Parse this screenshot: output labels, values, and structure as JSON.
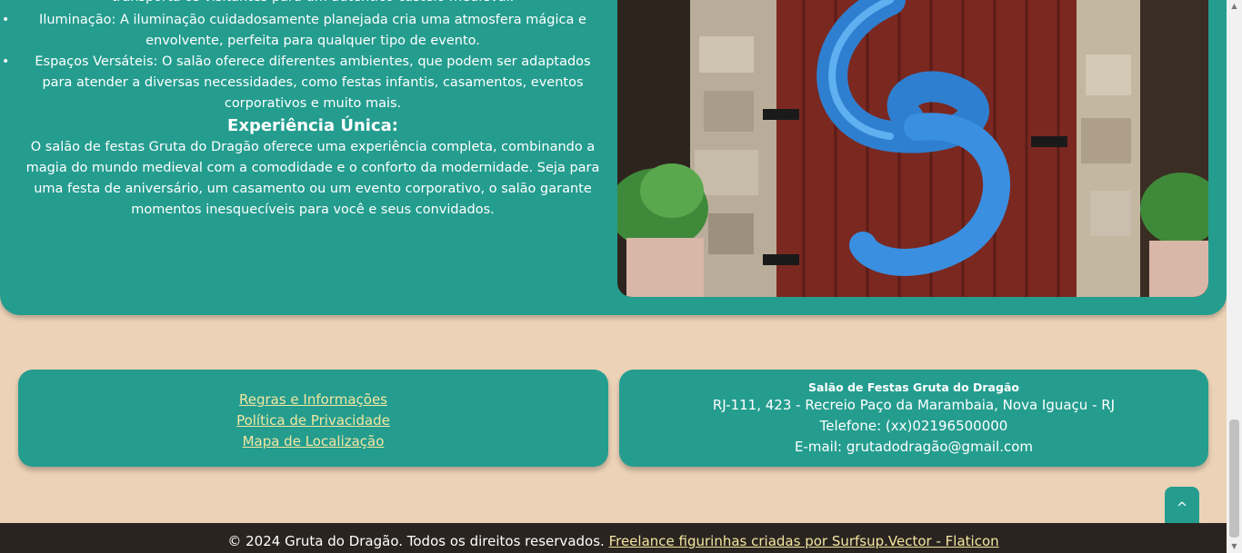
{
  "content": {
    "cut_line": "transporta os visitantes para um autêntico castelo medieval.",
    "bullets": [
      "Iluminação: A iluminação cuidadosamente planejada cria uma atmosfera mágica e envolvente, perfeita para qualquer tipo de evento.",
      "Espaços Versáteis: O salão oferece diferentes ambientes, que podem ser adaptados para atender a diversas necessidades, como festas infantis, casamentos, eventos corporativos e muito mais."
    ],
    "section_title": "Experiência Única:",
    "paragraph": "O salão de festas Gruta do Dragão oferece uma experiência completa, combinando a magia do mundo medieval com a comodidade e o conforto da modernidade. Seja para uma festa de aniversário, um casamento ou um evento corporativo, o salão garante momentos inesquecíveis para você e seus convidados."
  },
  "footer": {
    "links": [
      "Regras e Informações",
      "Política de Privacidade",
      "Mapa de Localização"
    ],
    "info": {
      "name": "Salão de Festas Gruta do Dragão",
      "address": "RJ-111, 423 - Recreio Paço da Marambaia, Nova Iguaçu - RJ",
      "phone": "Telefone: (xx)02196500000",
      "email": "E-mail: grutadodragão@gmail.com"
    },
    "to_top": "^",
    "copyright": "© 2024 Gruta do Dragão. Todos os direitos reservados.",
    "credit_link": "Freelance figurinhas criadas por Surfsup.Vector - Flaticon"
  },
  "colors": {
    "teal": "#249d8f",
    "sand": "#ecd3b7",
    "link_yellow": "#f3e6a0",
    "dark_bar": "#2a2420"
  }
}
